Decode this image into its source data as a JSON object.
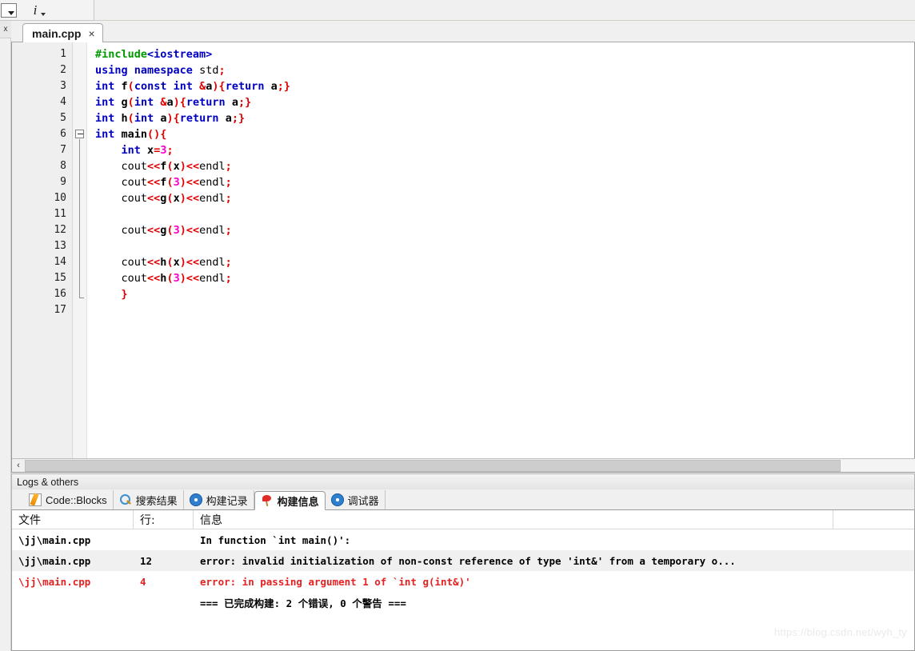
{
  "toolbar": {
    "combo_name": "toolbar-combobox",
    "info_icon": "info-icon",
    "info_label": "i"
  },
  "left_dock": {
    "close_label": "x"
  },
  "editor": {
    "tab": {
      "label": "main.cpp",
      "close_label": "×"
    },
    "line_numbers": [
      "1",
      "2",
      "3",
      "4",
      "5",
      "6",
      "7",
      "8",
      "9",
      "10",
      "11",
      "12",
      "13",
      "14",
      "15",
      "16",
      "17"
    ],
    "fold_marker_line": 6,
    "fold_end_line": 16,
    "lines": [
      [
        {
          "t": "#include",
          "c": "pp"
        },
        {
          "t": "<iostream>",
          "c": "hdr"
        }
      ],
      [
        {
          "t": "using",
          "c": "k"
        },
        {
          "t": " ",
          "c": "pl"
        },
        {
          "t": "namespace",
          "c": "k"
        },
        {
          "t": " std",
          "c": "pl"
        },
        {
          "t": ";",
          "c": "p"
        }
      ],
      [
        {
          "t": "int",
          "c": "k"
        },
        {
          "t": " ",
          "c": "pl"
        },
        {
          "t": "f",
          "c": "id"
        },
        {
          "t": "(",
          "c": "p"
        },
        {
          "t": "const",
          "c": "k"
        },
        {
          "t": " ",
          "c": "pl"
        },
        {
          "t": "int",
          "c": "k"
        },
        {
          "t": " ",
          "c": "pl"
        },
        {
          "t": "&",
          "c": "p"
        },
        {
          "t": "a",
          "c": "id"
        },
        {
          "t": ")",
          "c": "p"
        },
        {
          "t": "{",
          "c": "p"
        },
        {
          "t": "return",
          "c": "k"
        },
        {
          "t": " ",
          "c": "pl"
        },
        {
          "t": "a",
          "c": "id"
        },
        {
          "t": ";}",
          "c": "p"
        }
      ],
      [
        {
          "t": "int",
          "c": "k"
        },
        {
          "t": " ",
          "c": "pl"
        },
        {
          "t": "g",
          "c": "id"
        },
        {
          "t": "(",
          "c": "p"
        },
        {
          "t": "int",
          "c": "k"
        },
        {
          "t": " ",
          "c": "pl"
        },
        {
          "t": "&",
          "c": "p"
        },
        {
          "t": "a",
          "c": "id"
        },
        {
          "t": ")",
          "c": "p"
        },
        {
          "t": "{",
          "c": "p"
        },
        {
          "t": "return",
          "c": "k"
        },
        {
          "t": " ",
          "c": "pl"
        },
        {
          "t": "a",
          "c": "id"
        },
        {
          "t": ";}",
          "c": "p"
        }
      ],
      [
        {
          "t": "int",
          "c": "k"
        },
        {
          "t": " ",
          "c": "pl"
        },
        {
          "t": "h",
          "c": "id"
        },
        {
          "t": "(",
          "c": "p"
        },
        {
          "t": "int",
          "c": "k"
        },
        {
          "t": " ",
          "c": "pl"
        },
        {
          "t": "a",
          "c": "id"
        },
        {
          "t": ")",
          "c": "p"
        },
        {
          "t": "{",
          "c": "p"
        },
        {
          "t": "return",
          "c": "k"
        },
        {
          "t": " ",
          "c": "pl"
        },
        {
          "t": "a",
          "c": "id"
        },
        {
          "t": ";}",
          "c": "p"
        }
      ],
      [
        {
          "t": "int",
          "c": "k"
        },
        {
          "t": " ",
          "c": "pl"
        },
        {
          "t": "main",
          "c": "id"
        },
        {
          "t": "(){",
          "c": "p"
        }
      ],
      [
        {
          "t": "    ",
          "c": "pl"
        },
        {
          "t": "int",
          "c": "k"
        },
        {
          "t": " ",
          "c": "pl"
        },
        {
          "t": "x",
          "c": "id"
        },
        {
          "t": "=",
          "c": "p"
        },
        {
          "t": "3",
          "c": "n"
        },
        {
          "t": ";",
          "c": "p"
        }
      ],
      [
        {
          "t": "    cout",
          "c": "pl"
        },
        {
          "t": "<<",
          "c": "p"
        },
        {
          "t": "f",
          "c": "id"
        },
        {
          "t": "(",
          "c": "p"
        },
        {
          "t": "x",
          "c": "id"
        },
        {
          "t": ")",
          "c": "p"
        },
        {
          "t": "<<",
          "c": "p"
        },
        {
          "t": "endl",
          "c": "pl"
        },
        {
          "t": ";",
          "c": "p"
        }
      ],
      [
        {
          "t": "    cout",
          "c": "pl"
        },
        {
          "t": "<<",
          "c": "p"
        },
        {
          "t": "f",
          "c": "id"
        },
        {
          "t": "(",
          "c": "p"
        },
        {
          "t": "3",
          "c": "n"
        },
        {
          "t": ")",
          "c": "p"
        },
        {
          "t": "<<",
          "c": "p"
        },
        {
          "t": "endl",
          "c": "pl"
        },
        {
          "t": ";",
          "c": "p"
        }
      ],
      [
        {
          "t": "    cout",
          "c": "pl"
        },
        {
          "t": "<<",
          "c": "p"
        },
        {
          "t": "g",
          "c": "id"
        },
        {
          "t": "(",
          "c": "p"
        },
        {
          "t": "x",
          "c": "id"
        },
        {
          "t": ")",
          "c": "p"
        },
        {
          "t": "<<",
          "c": "p"
        },
        {
          "t": "endl",
          "c": "pl"
        },
        {
          "t": ";",
          "c": "p"
        }
      ],
      [],
      [
        {
          "t": "    cout",
          "c": "pl"
        },
        {
          "t": "<<",
          "c": "p"
        },
        {
          "t": "g",
          "c": "id"
        },
        {
          "t": "(",
          "c": "p"
        },
        {
          "t": "3",
          "c": "n"
        },
        {
          "t": ")",
          "c": "p"
        },
        {
          "t": "<<",
          "c": "p"
        },
        {
          "t": "endl",
          "c": "pl"
        },
        {
          "t": ";",
          "c": "p"
        }
      ],
      [],
      [
        {
          "t": "    cout",
          "c": "pl"
        },
        {
          "t": "<<",
          "c": "p"
        },
        {
          "t": "h",
          "c": "id"
        },
        {
          "t": "(",
          "c": "p"
        },
        {
          "t": "x",
          "c": "id"
        },
        {
          "t": ")",
          "c": "p"
        },
        {
          "t": "<<",
          "c": "p"
        },
        {
          "t": "endl",
          "c": "pl"
        },
        {
          "t": ";",
          "c": "p"
        }
      ],
      [
        {
          "t": "    cout",
          "c": "pl"
        },
        {
          "t": "<<",
          "c": "p"
        },
        {
          "t": "h",
          "c": "id"
        },
        {
          "t": "(",
          "c": "p"
        },
        {
          "t": "3",
          "c": "n"
        },
        {
          "t": ")",
          "c": "p"
        },
        {
          "t": "<<",
          "c": "p"
        },
        {
          "t": "endl",
          "c": "pl"
        },
        {
          "t": ";",
          "c": "p"
        }
      ],
      [
        {
          "t": "    ",
          "c": "pl"
        },
        {
          "t": "}",
          "c": "p"
        }
      ],
      []
    ],
    "scroll_left_arrow": "‹"
  },
  "logs": {
    "title": "Logs & others",
    "tabs": [
      {
        "label": "Code::Blocks",
        "icon": "pencil-icon",
        "active": false
      },
      {
        "label": "搜索结果",
        "icon": "magnifier-icon",
        "active": false
      },
      {
        "label": "构建记录",
        "icon": "gear-icon",
        "active": false
      },
      {
        "label": "构建信息",
        "icon": "pin-icon",
        "active": true
      },
      {
        "label": "调试器",
        "icon": "gear-icon",
        "active": false
      }
    ],
    "columns": [
      "文件",
      "行:",
      "信息"
    ],
    "rows": [
      {
        "file": "\\jj\\main.cpp",
        "line": "",
        "message": "In function `int main()':",
        "error": false,
        "highlight": false
      },
      {
        "file": "\\jj\\main.cpp",
        "line": "12",
        "message": "error: invalid initialization of non-const reference of type 'int&' from a temporary o...",
        "error": false,
        "highlight": true
      },
      {
        "file": "\\jj\\main.cpp",
        "line": "4",
        "message": "error: in passing argument 1 of `int g(int&)'",
        "error": true,
        "highlight": false
      },
      {
        "file": "",
        "line": "",
        "message": "=== 已完成构建: 2 个错误, 0 个警告 ===",
        "error": false,
        "highlight": false
      }
    ]
  },
  "watermark": "https://blog.csdn.net/wyh_ty",
  "colors": {
    "keyword": "#0000c0",
    "punctuation": "#e00000",
    "number": "#ff00c8",
    "preprocessor": "#009900",
    "error": "#e42222",
    "panel_bg": "#f0f0f0"
  }
}
